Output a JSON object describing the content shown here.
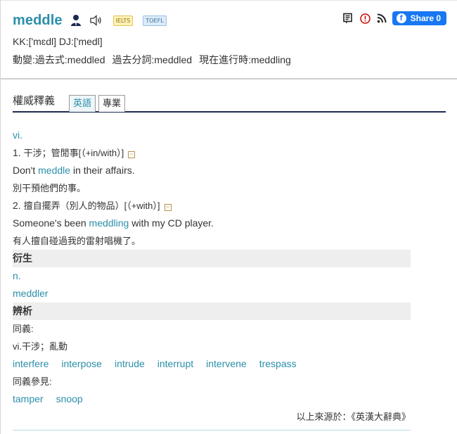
{
  "header": {
    "word": "meddle",
    "badges": {
      "ielts": "IELTS",
      "toefl": "TOEFL"
    },
    "pronunciation": "KK:['mɛdl] DJ:['medl]",
    "forms": {
      "label": "動變:",
      "past": "過去式:meddled",
      "past_participle": "過去分詞:meddled",
      "present_participle": "現在進行時:meddling"
    },
    "share_label": "Share 0",
    "icons": [
      "person-icon",
      "speaker-icon",
      "note-icon",
      "alert-icon",
      "rss-icon",
      "facebook-icon"
    ]
  },
  "tabs": {
    "heading": "權威釋義",
    "items": [
      {
        "label": "英語",
        "active": true
      },
      {
        "label": "專業",
        "active": false
      }
    ]
  },
  "definitions": {
    "pos": "vi.",
    "entries": [
      {
        "num": "1.",
        "meaning": "干涉；管閒事[（+in/with）]",
        "example_pre": "Don't ",
        "example_word": "meddle",
        "example_post": " in their affairs.",
        "translation": "別干預他們的事。"
      },
      {
        "num": "2.",
        "meaning": "擅自擺弄（別人的物品）[（+with）]",
        "example_pre": "Someone's been ",
        "example_word": "meddling",
        "example_post": " with my CD player.",
        "translation": "有人擅自碰過我的雷射唱機了。"
      }
    ]
  },
  "derivative": {
    "heading": "衍生",
    "pos": "n.",
    "word": "meddler"
  },
  "analysis": {
    "heading": "辨析",
    "synonyms_label": "同義:",
    "synonyms_sense": "vi.干涉；亂動",
    "synonyms": [
      "interfere",
      "interpose",
      "intrude",
      "interrupt",
      "intervene",
      "trespass"
    ],
    "see_also_label": "同義參見:",
    "see_also": [
      "tamper",
      "snoop"
    ]
  },
  "source": "以上來源於：《英漢大辭典》",
  "colors": {
    "accent": "#2a8fa9",
    "tab_rule": "#1d2a52",
    "section_bg": "#eeeeee",
    "facebook": "#1877f2"
  }
}
